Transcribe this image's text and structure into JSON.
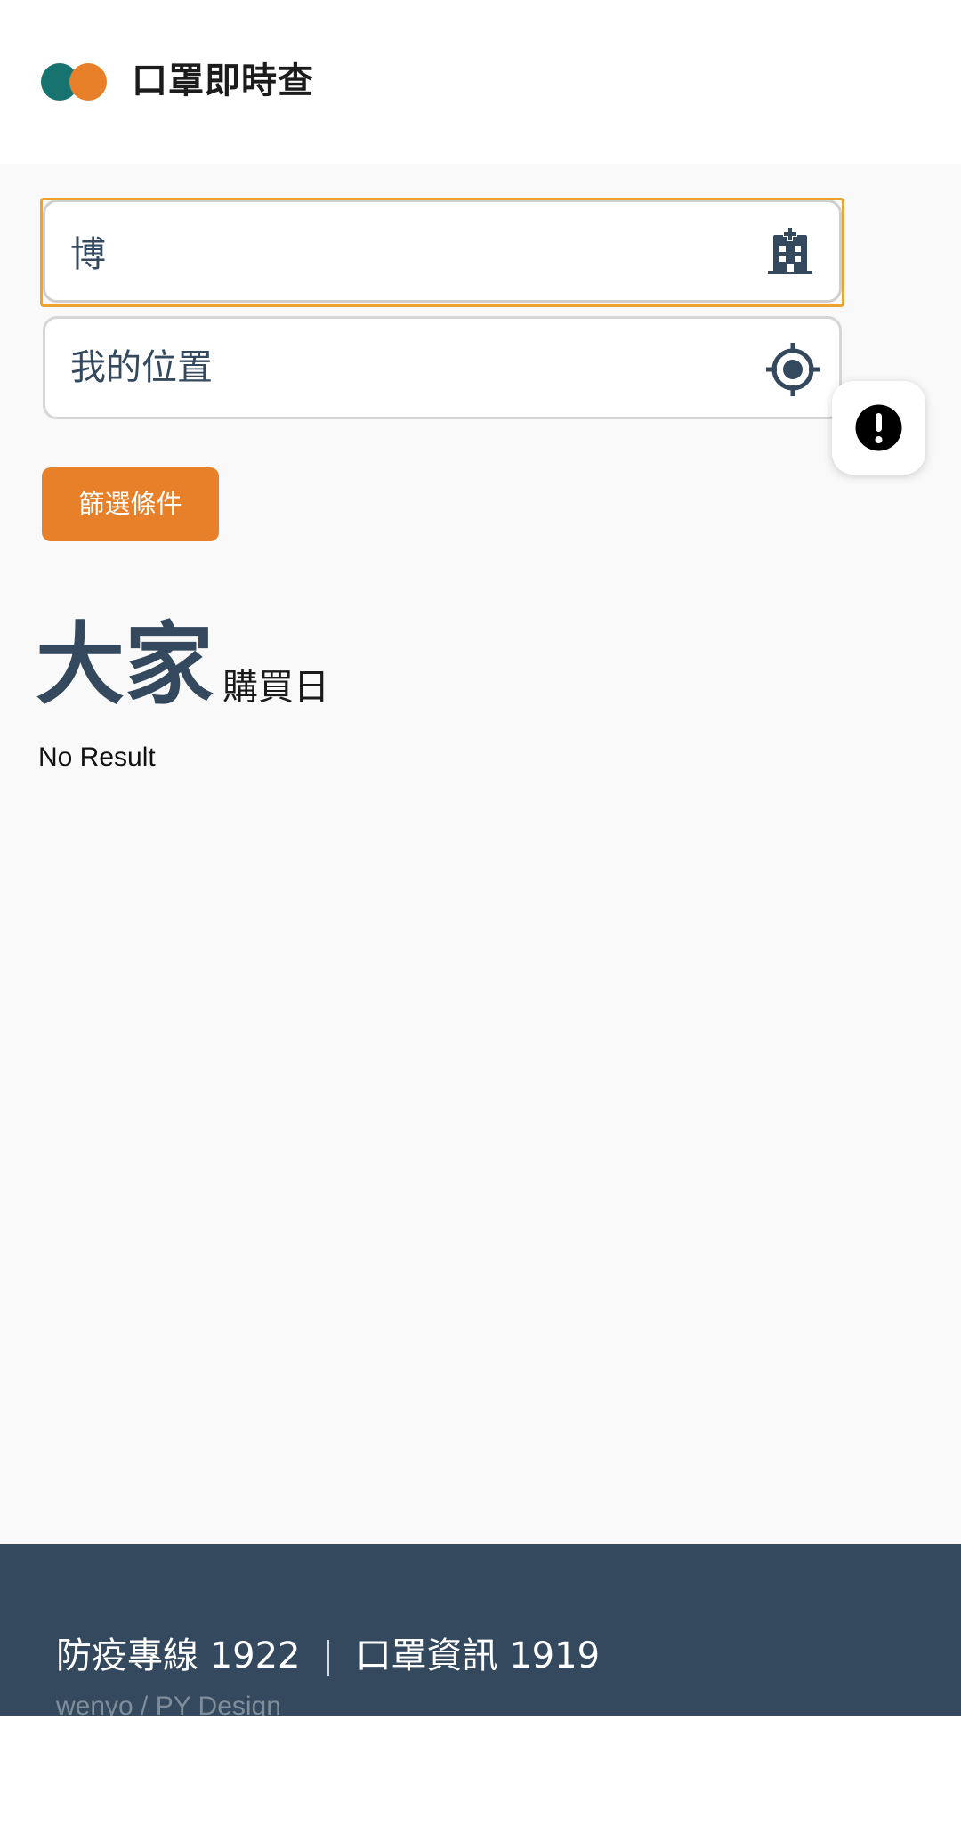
{
  "header": {
    "title": "口罩即時查",
    "logo_colors": [
      "#16736f",
      "#e8802a"
    ]
  },
  "search": {
    "keyword_value": "博",
    "keyword_icon": "hospital-building-icon",
    "location_placeholder": "我的位置",
    "location_icon": "crosshair-location-icon"
  },
  "filter_button": {
    "label": "篩選條件",
    "color": "#e8802a"
  },
  "report_button": {
    "icon": "exclamation-circle-icon"
  },
  "purchase": {
    "day_label": "大家",
    "day_suffix": "購買日",
    "result_text": "No Result"
  },
  "footer": {
    "hotline_epidemic": "防疫專線 1922",
    "hotline_mask": "口罩資訊 1919",
    "credit": "wenyo / PY Design",
    "background": "#34495e"
  }
}
